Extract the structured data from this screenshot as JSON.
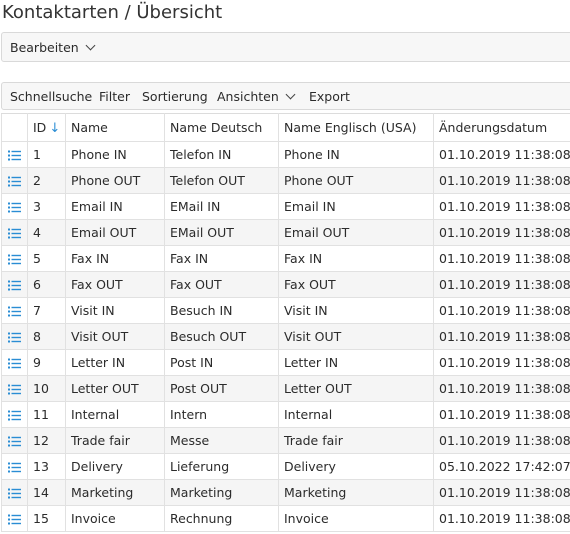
{
  "page": {
    "title": "Kontaktarten / Übersicht"
  },
  "edit_bar": {
    "bearbeiten": "Bearbeiten"
  },
  "toolbar": {
    "schnellsuche": "Schnellsuche",
    "filter": "Filter",
    "sortierung": "Sortierung",
    "ansichten": "Ansichten",
    "export": "Export"
  },
  "table": {
    "headers": {
      "id": "ID",
      "name": "Name",
      "name_de": "Name Deutsch",
      "name_en": "Name Englisch (USA)",
      "changed": "Änderungsdatum"
    },
    "sort_indicator": "↓",
    "rows": [
      {
        "id": "1",
        "name": "Phone IN",
        "name_de": "Telefon IN",
        "name_en": "Phone IN",
        "changed": "01.10.2019 11:38:08"
      },
      {
        "id": "2",
        "name": "Phone OUT",
        "name_de": "Telefon OUT",
        "name_en": "Phone OUT",
        "changed": "01.10.2019 11:38:08"
      },
      {
        "id": "3",
        "name": "Email IN",
        "name_de": "EMail IN",
        "name_en": "Email IN",
        "changed": "01.10.2019 11:38:08"
      },
      {
        "id": "4",
        "name": "Email OUT",
        "name_de": "EMail OUT",
        "name_en": "Email OUT",
        "changed": "01.10.2019 11:38:08"
      },
      {
        "id": "5",
        "name": "Fax IN",
        "name_de": "Fax IN",
        "name_en": "Fax IN",
        "changed": "01.10.2019 11:38:08"
      },
      {
        "id": "6",
        "name": "Fax OUT",
        "name_de": "Fax OUT",
        "name_en": "Fax OUT",
        "changed": "01.10.2019 11:38:08"
      },
      {
        "id": "7",
        "name": "Visit IN",
        "name_de": "Besuch IN",
        "name_en": "Visit IN",
        "changed": "01.10.2019 11:38:08"
      },
      {
        "id": "8",
        "name": "Visit OUT",
        "name_de": "Besuch OUT",
        "name_en": "Visit OUT",
        "changed": "01.10.2019 11:38:08"
      },
      {
        "id": "9",
        "name": "Letter IN",
        "name_de": "Post IN",
        "name_en": "Letter IN",
        "changed": "01.10.2019 11:38:08"
      },
      {
        "id": "10",
        "name": "Letter OUT",
        "name_de": "Post OUT",
        "name_en": "Letter OUT",
        "changed": "01.10.2019 11:38:08"
      },
      {
        "id": "11",
        "name": "Internal",
        "name_de": "Intern",
        "name_en": "Internal",
        "changed": "01.10.2019 11:38:08"
      },
      {
        "id": "12",
        "name": "Trade fair",
        "name_de": "Messe",
        "name_en": "Trade fair",
        "changed": "01.10.2019 11:38:08"
      },
      {
        "id": "13",
        "name": "Delivery",
        "name_de": "Lieferung",
        "name_en": "Delivery",
        "changed": "05.10.2022 17:42:07"
      },
      {
        "id": "14",
        "name": "Marketing",
        "name_de": "Marketing",
        "name_en": "Marketing",
        "changed": "01.10.2019 11:38:08"
      },
      {
        "id": "15",
        "name": "Invoice",
        "name_de": "Rechnung",
        "name_en": "Invoice",
        "changed": "01.10.2019 11:38:08"
      }
    ]
  },
  "colors": {
    "accent": "#2a8dd4",
    "row_alt": "#f5f5f5",
    "toolbar_bg": "#f7f7f7"
  },
  "icons": {
    "row_action": "list-icon",
    "dropdown": "chevron-down-icon",
    "sort": "sort-down-arrow-icon"
  }
}
